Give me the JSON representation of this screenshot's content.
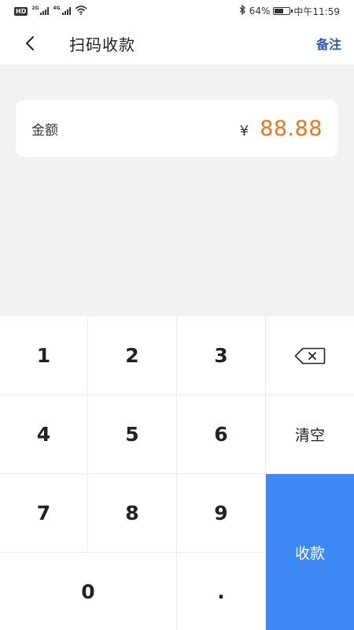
{
  "status_bar": {
    "hd_label": "HD",
    "network_2g": "2G",
    "network_4g": "4G",
    "battery_percent": "64%",
    "battery_level": 0.64,
    "time": "中午11:59",
    "icons": [
      "hd-icon",
      "signal-icon",
      "wifi-icon",
      "bluetooth-icon",
      "battery-icon"
    ]
  },
  "nav": {
    "back_icon": "chevron-left-icon",
    "title": "扫码收款",
    "note_label": "备注"
  },
  "amount": {
    "label": "金额",
    "currency_symbol": "¥",
    "value": "88.88",
    "value_color": "#e8761f"
  },
  "keypad": {
    "digits": [
      "1",
      "2",
      "3",
      "4",
      "5",
      "6",
      "7",
      "8",
      "9",
      "0",
      "."
    ],
    "backspace_icon": "backspace-icon",
    "clear_label": "清空",
    "submit_label": "收款",
    "submit_color": "#3e88f5"
  }
}
